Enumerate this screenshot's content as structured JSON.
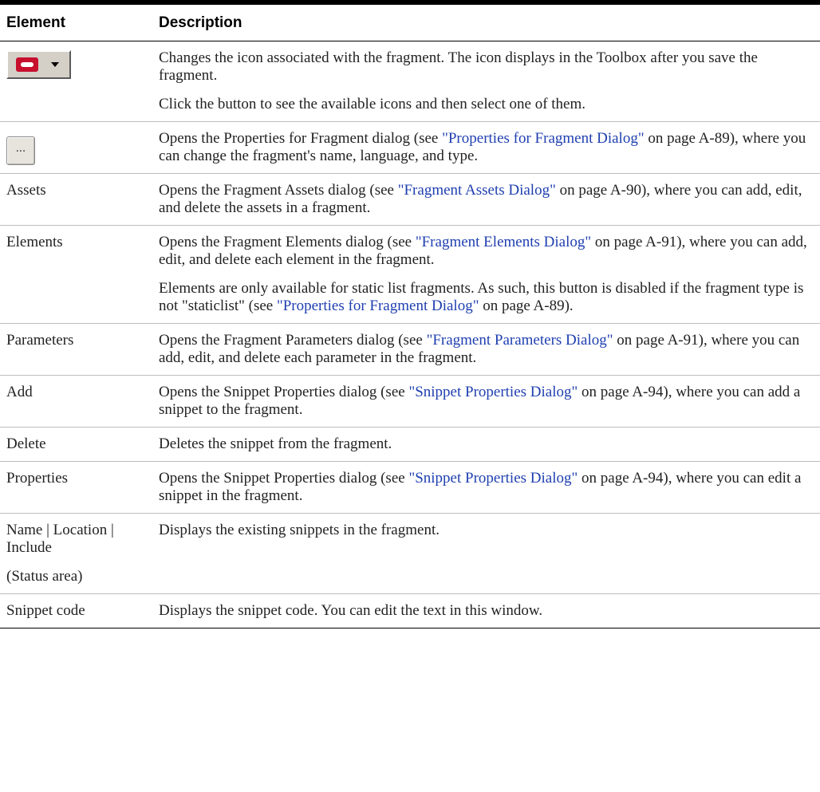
{
  "header": {
    "col_element": "Element",
    "col_description": "Description"
  },
  "rows": {
    "icon_selector": {
      "icon": "icon-selector-dropdown",
      "desc_1": "Changes the icon associated with the fragment. The icon displays in the Toolbox after you save the fragment.",
      "desc_2": "Click the button to see the available icons and then select one of them."
    },
    "ellipsis": {
      "icon": "ellipsis-button",
      "label": "...",
      "pre": "Opens the Properties for Fragment dialog (see ",
      "link": "\"Properties for Fragment Dialog\"",
      "post": " on page A-89), where you can change the fragment's name, language, and type."
    },
    "assets": {
      "element": "Assets",
      "pre": "Opens the Fragment Assets dialog (see ",
      "link": "\"Fragment Assets Dialog\"",
      "post": " on page A-90), where you can add, edit, and delete the assets in a fragment."
    },
    "elements": {
      "element": "Elements",
      "pre": "Opens the Fragment Elements dialog (see ",
      "link": "\"Fragment Elements Dialog\"",
      "post": " on page A-91), where you can add, edit, and delete each element in the fragment.",
      "p2_pre": "Elements are only available for static list fragments. As such, this button is disabled if the fragment type is not \"staticlist\" (see ",
      "p2_link": "\"Properties for Fragment Dialog\"",
      "p2_post": " on page A-89)."
    },
    "parameters": {
      "element": "Parameters",
      "pre": "Opens the Fragment Parameters dialog (see ",
      "link": "\"Fragment Parameters Dialog\"",
      "post": " on page A-91), where you can add, edit, and delete each parameter in the fragment."
    },
    "add": {
      "element": "Add",
      "pre": "Opens the Snippet Properties dialog (see ",
      "link": "\"Snippet Properties Dialog\"",
      "post": " on page A-94), where you can add a snippet to the fragment."
    },
    "delete": {
      "element": "Delete",
      "desc": "Deletes the snippet from the fragment."
    },
    "properties": {
      "element": "Properties",
      "pre": "Opens the Snippet Properties dialog (see ",
      "link": "\"Snippet Properties Dialog\"",
      "post": " on page A-94), where you can edit a snippet in the fragment."
    },
    "snippet_list": {
      "element_1": "Name | Location | Include",
      "element_2": "(Status area)",
      "desc": "Displays the existing snippets in the fragment."
    },
    "snippet_code": {
      "element": "Snippet code",
      "desc": "Displays the snippet code. You can edit the text in this window."
    }
  },
  "colors": {
    "link": "#1f3fb0",
    "icon_red": "#c8102e",
    "button_face": "#d4d0c8"
  }
}
